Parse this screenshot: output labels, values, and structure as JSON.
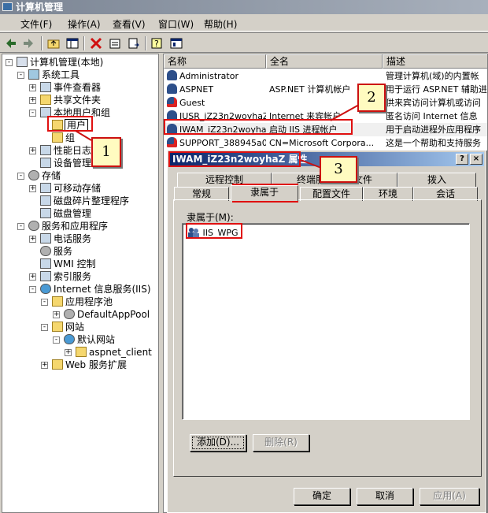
{
  "window": {
    "title": "计算机管理"
  },
  "menu": [
    "文件(F)",
    "操作(A)",
    "查看(V)",
    "窗口(W)",
    "帮助(H)"
  ],
  "tree": [
    {
      "label": "计算机管理(本地)",
      "indent": 0
    },
    {
      "label": "系统工具",
      "indent": 1
    },
    {
      "label": "事件查看器",
      "indent": 2
    },
    {
      "label": "共享文件夹",
      "indent": 2
    },
    {
      "label": "本地用户和组",
      "indent": 2
    },
    {
      "label": "用户",
      "indent": 3
    },
    {
      "label": "组",
      "indent": 3
    },
    {
      "label": "性能日志",
      "indent": 2
    },
    {
      "label": "设备管理器",
      "indent": 2
    },
    {
      "label": "存储",
      "indent": 1
    },
    {
      "label": "可移动存储",
      "indent": 2
    },
    {
      "label": "磁盘碎片整理程序",
      "indent": 2
    },
    {
      "label": "磁盘管理",
      "indent": 2
    },
    {
      "label": "服务和应用程序",
      "indent": 1
    },
    {
      "label": "电话服务",
      "indent": 2
    },
    {
      "label": "服务",
      "indent": 2
    },
    {
      "label": "WMI 控制",
      "indent": 2
    },
    {
      "label": "索引服务",
      "indent": 2
    },
    {
      "label": "Internet 信息服务(IIS)",
      "indent": 2
    },
    {
      "label": "应用程序池",
      "indent": 3
    },
    {
      "label": "DefaultAppPool",
      "indent": 4
    },
    {
      "label": "网站",
      "indent": 3
    },
    {
      "label": "默认网站",
      "indent": 4
    },
    {
      "label": "aspnet_client",
      "indent": 5
    },
    {
      "label": "Web 服务扩展",
      "indent": 3
    }
  ],
  "list": {
    "columns": [
      "名称",
      "全名",
      "描述"
    ],
    "rows": [
      {
        "name": "Administrator",
        "full": "",
        "desc": "管理计算机(域)的内置帐"
      },
      {
        "name": "ASPNET",
        "full": "ASP.NET 计算机帐户",
        "desc": "用于运行 ASP.NET 辅助进"
      },
      {
        "name": "Guest",
        "full": "",
        "desc": "供来宾访问计算机或访问"
      },
      {
        "name": "IUSR_iZ23n2woyhaZ",
        "full": "Internet 来宾帐户",
        "desc": "匿名访问 Internet 信息"
      },
      {
        "name": "IWAM_iZ23n2woyhaZ",
        "full": "启动 IIS 进程帐户",
        "desc": "用于启动进程外应用程序"
      },
      {
        "name": "SUPPORT_388945a0",
        "full": "CN=Microsoft Corpora...",
        "desc": "这是一个帮助和支持服务"
      }
    ]
  },
  "dialog": {
    "title": "IWAM_iZ23n2woyhaZ 属性",
    "help": "?",
    "close": "×",
    "tabs_back": [
      "远程控制",
      "终端服务配置文件",
      "拨入"
    ],
    "tabs_front": [
      "常规",
      "隶属于",
      "配置文件",
      "环境",
      "会话"
    ],
    "member_label": "隶属于(M):",
    "members": [
      "IIS_WPG"
    ],
    "add_btn": "添加(D)...",
    "remove_btn": "删除(R)",
    "ok_btn": "确定",
    "cancel_btn": "取消",
    "apply_btn": "应用(A)"
  },
  "callouts": [
    "1",
    "2",
    "3"
  ]
}
